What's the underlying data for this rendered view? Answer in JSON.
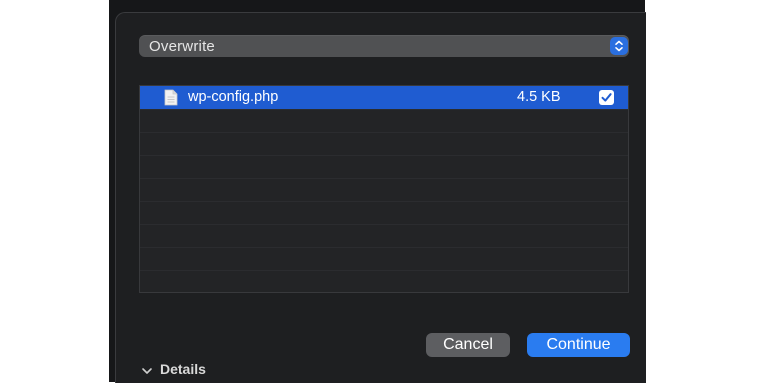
{
  "dialog": {
    "action_select": {
      "selected": "Overwrite",
      "stepper_icon": "up-down-chevron-icon"
    },
    "file_list": {
      "items": [
        {
          "name": "wp-config.php",
          "size": "4.5 KB",
          "checked": true,
          "icon": "document-icon"
        }
      ]
    },
    "buttons": {
      "cancel_label": "Cancel",
      "continue_label": "Continue"
    },
    "details": {
      "label": "Details",
      "icon": "chevron-down-icon"
    }
  },
  "colors": {
    "accent": "#2a7cf0",
    "selection": "#1f5cd1",
    "background": "#1e1f21"
  }
}
